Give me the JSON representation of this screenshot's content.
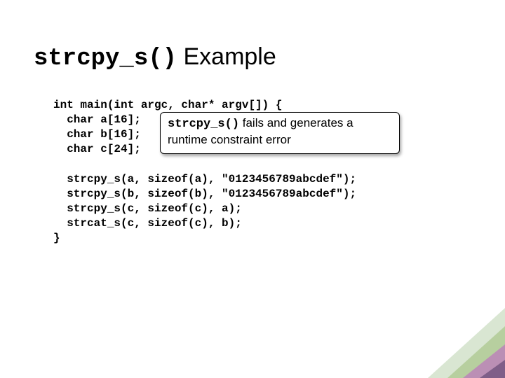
{
  "title": {
    "mono": "strcpy_s()",
    "rest": " Example"
  },
  "code": "int main(int argc, char* argv[]) {\n  char a[16];\n  char b[16];\n  char c[24];\n\n  strcpy_s(a, sizeof(a), \"0123456789abcdef\");\n  strcpy_s(b, sizeof(b), \"0123456789abcdef\");\n  strcpy_s(c, sizeof(c), a);\n  strcat_s(c, sizeof(c), b);\n}",
  "callout": {
    "mono": "strcpy_s()",
    "rest": " fails and generates a runtime constraint error"
  }
}
